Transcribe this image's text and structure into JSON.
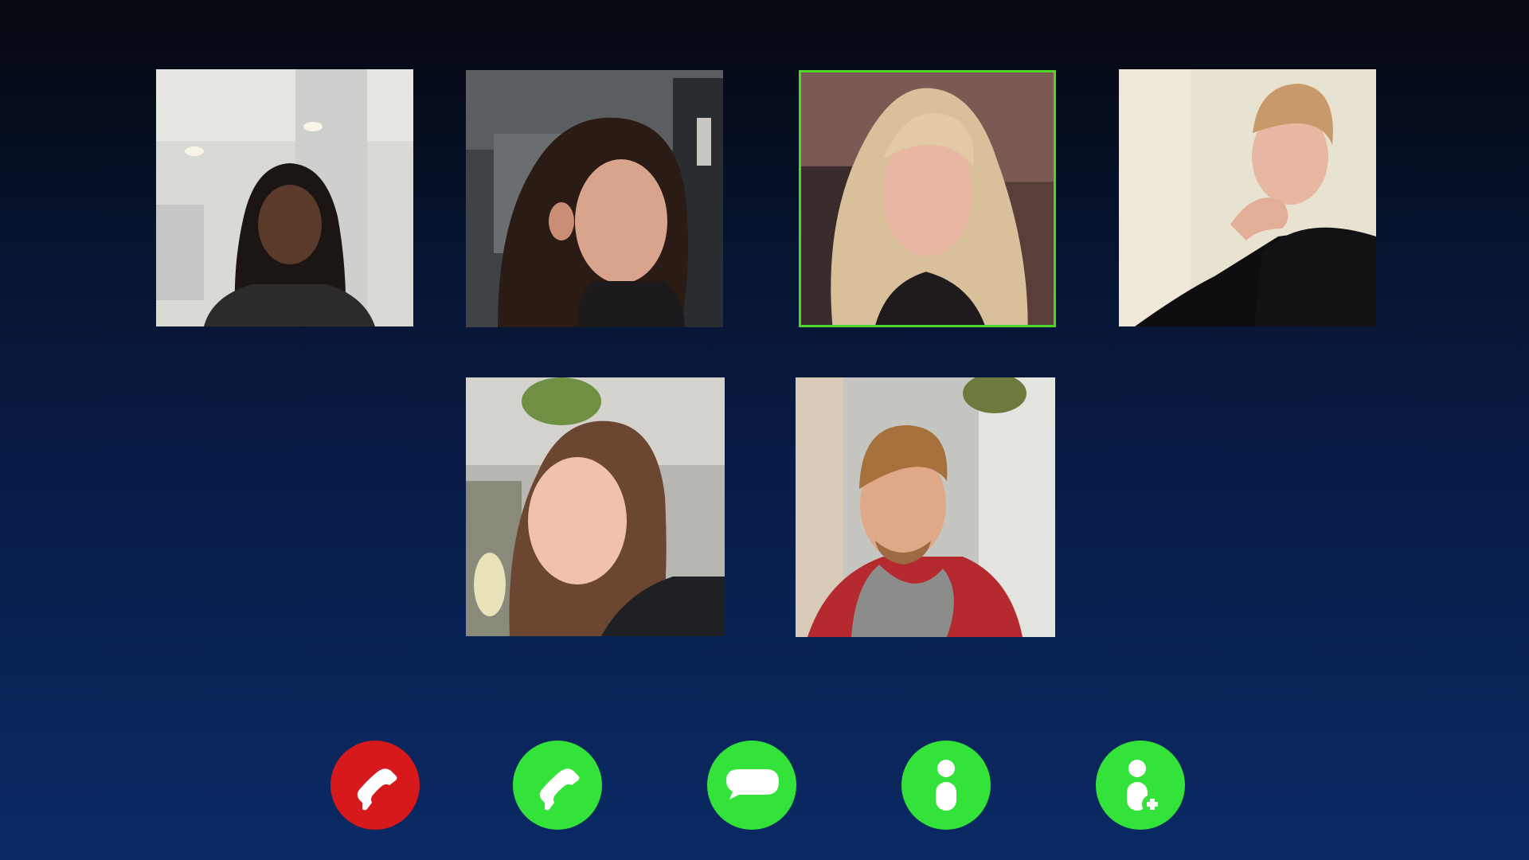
{
  "call": {
    "participants": [
      {
        "id": "p1",
        "speaking": false,
        "avatar": "participant-1-photo"
      },
      {
        "id": "p2",
        "speaking": false,
        "avatar": "participant-2-photo"
      },
      {
        "id": "p3",
        "speaking": true,
        "avatar": "participant-3-photo"
      },
      {
        "id": "p4",
        "speaking": false,
        "avatar": "participant-4-photo"
      },
      {
        "id": "p5",
        "speaking": false,
        "avatar": "participant-5-photo"
      },
      {
        "id": "p6",
        "speaking": false,
        "avatar": "participant-6-photo"
      }
    ],
    "active_speaker_color": "#4fd42a"
  },
  "controls": [
    {
      "name": "end-call",
      "icon": "phone-hangup-icon",
      "color": "#d7191c"
    },
    {
      "name": "accept-call",
      "icon": "phone-icon",
      "color": "#34e33a"
    },
    {
      "name": "chat",
      "icon": "chat-bubble-icon",
      "color": "#34e33a"
    },
    {
      "name": "participant-info",
      "icon": "person-icon",
      "color": "#34e33a"
    },
    {
      "name": "add-participant",
      "icon": "add-person-icon",
      "color": "#34e33a"
    }
  ],
  "colors": {
    "background_top": "#05080f",
    "background_bottom": "#0a2a64"
  }
}
